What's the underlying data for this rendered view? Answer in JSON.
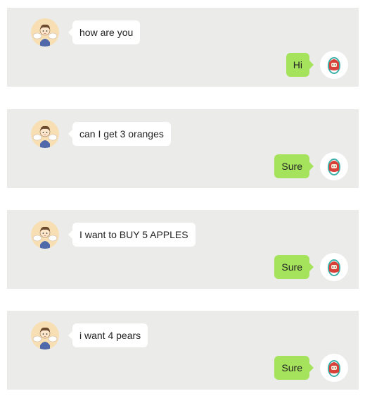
{
  "conversations": [
    {
      "user_message": "how are you",
      "bot_reply": "Hi",
      "user_avatar": "boy-with-wings-avatar",
      "bot_avatar": "red-hooded-character-avatar"
    },
    {
      "user_message": "can I get 3 oranges",
      "bot_reply": "Sure",
      "user_avatar": "boy-with-wings-avatar",
      "bot_avatar": "red-hooded-character-avatar"
    },
    {
      "user_message": "I want to BUY 5 APPLES",
      "bot_reply": "Sure",
      "user_avatar": "boy-with-wings-avatar",
      "bot_avatar": "red-hooded-character-avatar"
    },
    {
      "user_message": "i want 4 pears",
      "bot_reply": "Sure",
      "user_avatar": "boy-with-wings-avatar",
      "bot_avatar": "red-hooded-character-avatar"
    }
  ],
  "colors": {
    "panel_background": "#ebebea",
    "incoming_bubble": "#ffffff",
    "outgoing_bubble": "#a6e35c",
    "user_avatar_background": "#f8dfb3"
  }
}
